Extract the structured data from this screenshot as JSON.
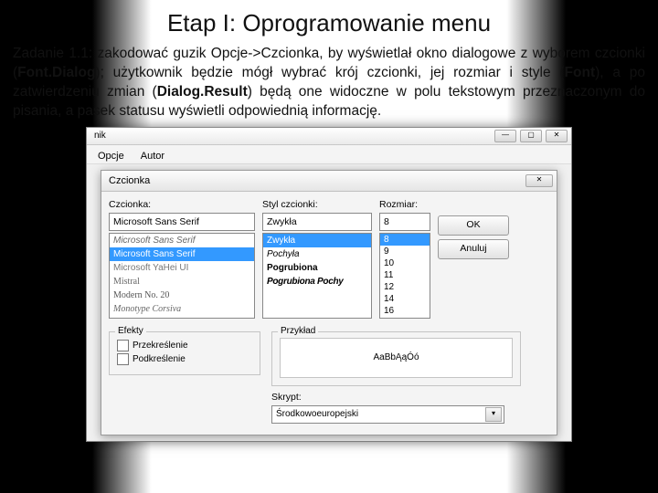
{
  "slide": {
    "title": "Etap I: Oprogramowanie menu",
    "task_prefix": "Zadanie 1.1: zakodować guzik Opcje->Czcionka, by wyświetlał okno dialogowe z wyborem czcionki (",
    "bold1": "Font.Dialog",
    "mid1": "); użytkownik będzie mógł wybrać krój czcionki, jej rozmiar i style (",
    "bold2": "Font",
    "mid2": "), a po zatwierdzeniu zmian (",
    "bold3": "Dialog.Result",
    "task_suffix": ") będą one widoczne w polu tekstowym przeznaczonym do pisania, a pasek statusu wyświetli odpowiednią informację."
  },
  "outer": {
    "title_fragment": "nik",
    "tabs": [
      "Opcje",
      "Autor"
    ]
  },
  "dialog": {
    "title": "Czcionka",
    "close_glyph": "✕",
    "labels": {
      "font": "Czcionka:",
      "style": "Styl czcionki:",
      "size": "Rozmiar:"
    },
    "selected": {
      "font": "Microsoft Sans Serif",
      "style": "Zwykła",
      "size": "8"
    },
    "font_options": [
      "Microsoft Sans Serif",
      "Microsoft Sans Serif",
      "Microsoft YaHei UI",
      "Mistral",
      "Modern No. 20",
      "Monotype Corsiva"
    ],
    "style_options": [
      "Zwykła",
      "Pochyła",
      "Pogrubiona",
      "Pogrubiona Pochy"
    ],
    "size_options": [
      "8",
      "9",
      "10",
      "11",
      "12",
      "14",
      "16"
    ],
    "buttons": {
      "ok": "OK",
      "cancel": "Anuluj"
    },
    "effects_legend": "Efekty",
    "effects": {
      "strike": "Przekreślenie",
      "underline": "Podkreślenie"
    },
    "sample_legend": "Przykład",
    "sample_text": "AaBbĄąÓó",
    "script_label": "Skrypt:",
    "script_value": "Środkowoeuropejski"
  }
}
